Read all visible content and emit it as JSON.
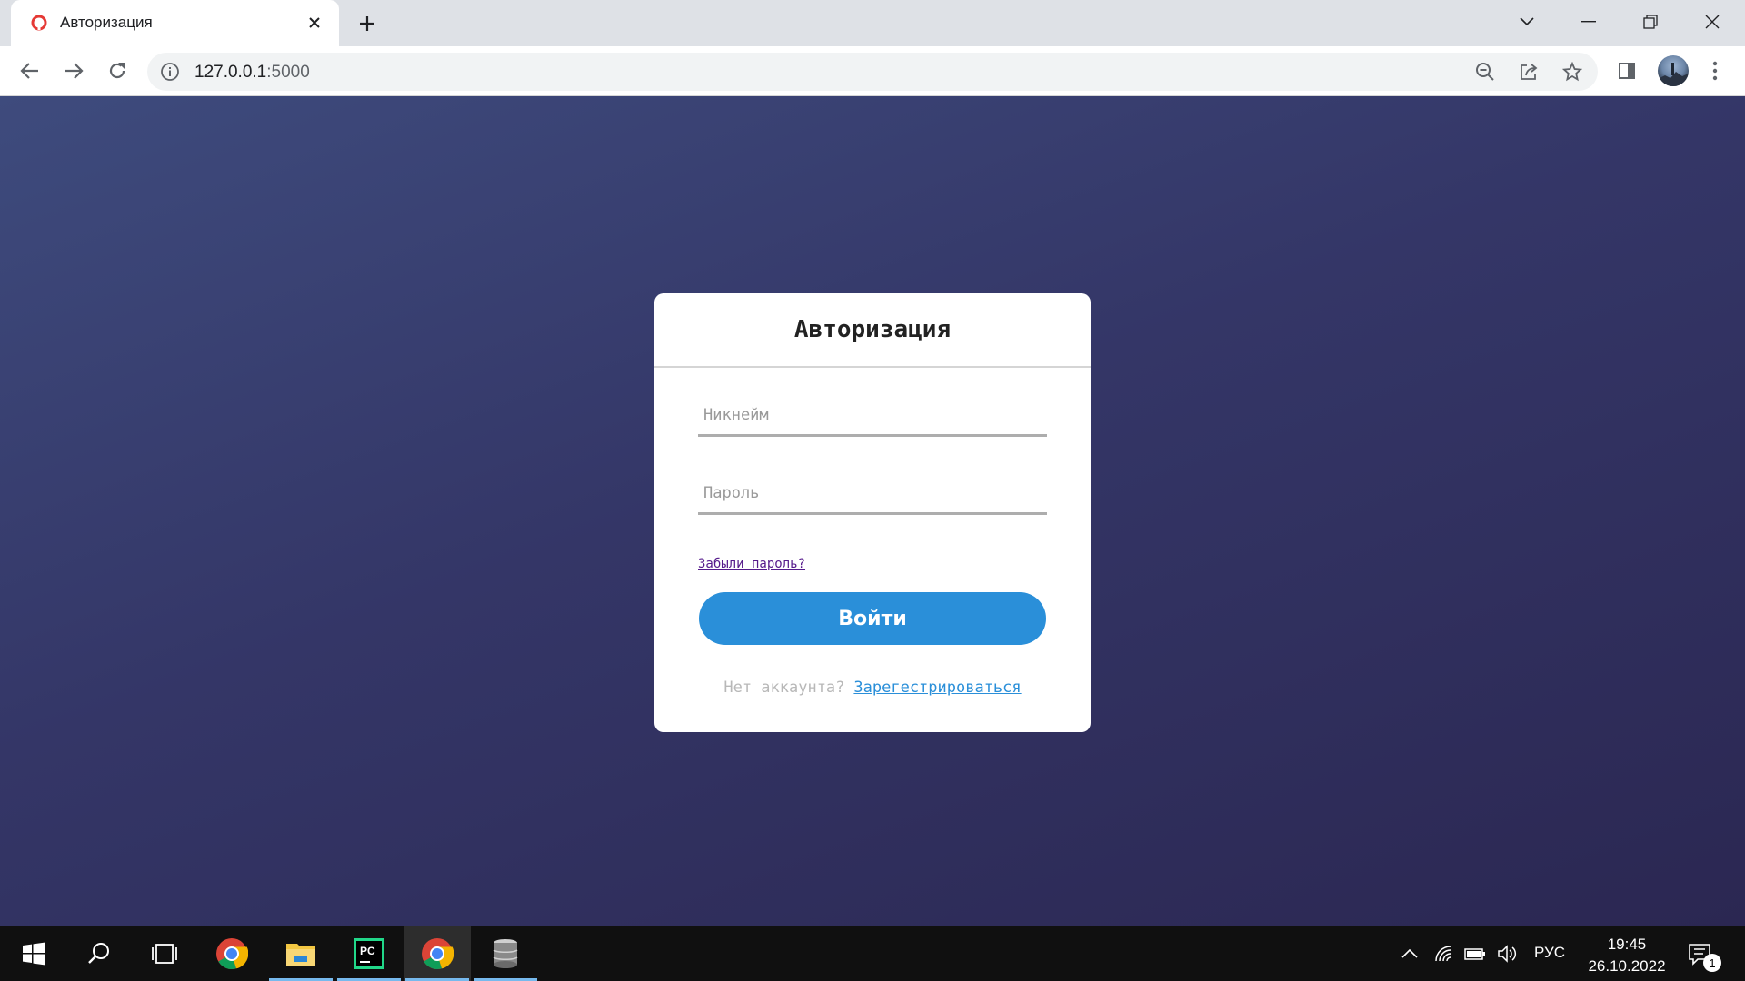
{
  "browser": {
    "tab_title": "Авторизация",
    "url_host": "127.0.0.1",
    "url_port": ":5000"
  },
  "login_form": {
    "title": "Авторизация",
    "nickname_placeholder": "Никнейм",
    "password_placeholder": "Пароль",
    "forgot_link": "Забыли пароль?",
    "submit_label": "Войти",
    "no_account_text": "Нет аккаунта?",
    "register_link": "Зарегестрироваться"
  },
  "taskbar": {
    "pinned": [
      "windows-start",
      "search",
      "task-view",
      "chrome",
      "file-explorer",
      "pycharm",
      "chrome-active",
      "database"
    ],
    "language": "РУС",
    "time": "19:45",
    "date": "26.10.2022",
    "notification_count": "1"
  },
  "colors": {
    "accent": "#2a8fd9",
    "page_bg_top": "#3e4b7d",
    "page_bg_bottom": "#2b2752"
  }
}
